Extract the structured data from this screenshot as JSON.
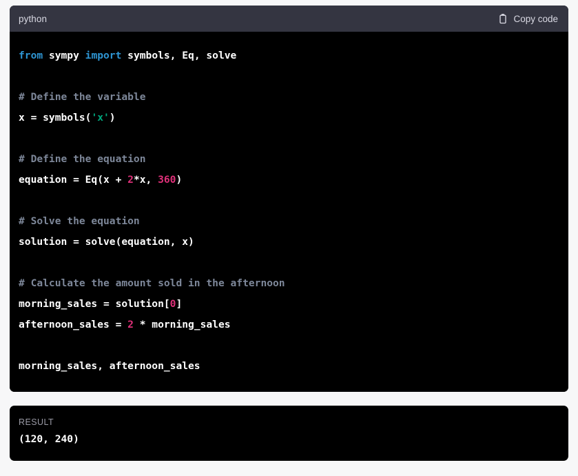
{
  "code_block": {
    "language_label": "python",
    "copy_button": {
      "label": "Copy code",
      "icon": "clipboard-icon"
    },
    "lines": [
      [
        {
          "t": "from ",
          "c": "kw"
        },
        {
          "t": "sympy ",
          "c": "plain"
        },
        {
          "t": "import ",
          "c": "kw"
        },
        {
          "t": "symbols, Eq, solve",
          "c": "plain"
        }
      ],
      [],
      [
        {
          "t": "# Define the variable",
          "c": "comment"
        }
      ],
      [
        {
          "t": "x = symbols(",
          "c": "plain"
        },
        {
          "t": "'x'",
          "c": "str"
        },
        {
          "t": ")",
          "c": "plain"
        }
      ],
      [],
      [
        {
          "t": "# Define the equation",
          "c": "comment"
        }
      ],
      [
        {
          "t": "equation = Eq(x + ",
          "c": "plain"
        },
        {
          "t": "2",
          "c": "num"
        },
        {
          "t": "*x, ",
          "c": "plain"
        },
        {
          "t": "360",
          "c": "num"
        },
        {
          "t": ")",
          "c": "plain"
        }
      ],
      [],
      [
        {
          "t": "# Solve the equation",
          "c": "comment"
        }
      ],
      [
        {
          "t": "solution = solve(equation, x)",
          "c": "plain"
        }
      ],
      [],
      [
        {
          "t": "# Calculate the amount sold in the afternoon",
          "c": "comment"
        }
      ],
      [
        {
          "t": "morning_sales = solution[",
          "c": "plain"
        },
        {
          "t": "0",
          "c": "num"
        },
        {
          "t": "]",
          "c": "plain"
        }
      ],
      [
        {
          "t": "afternoon_sales = ",
          "c": "plain"
        },
        {
          "t": "2",
          "c": "num"
        },
        {
          "t": " * morning_sales",
          "c": "plain"
        }
      ],
      [],
      [
        {
          "t": "morning_sales, afternoon_sales",
          "c": "plain"
        }
      ]
    ]
  },
  "result_block": {
    "label": "RESULT",
    "value": "(120, 240)"
  },
  "colors": {
    "page_background": "#f7f7f8",
    "code_background": "#000000",
    "header_background": "#343541",
    "keyword": "#2e95d3",
    "comment": "#7d8799",
    "string": "#00a67d",
    "number": "#df3079",
    "text": "#ffffff",
    "muted_text": "#d9d9e3"
  }
}
